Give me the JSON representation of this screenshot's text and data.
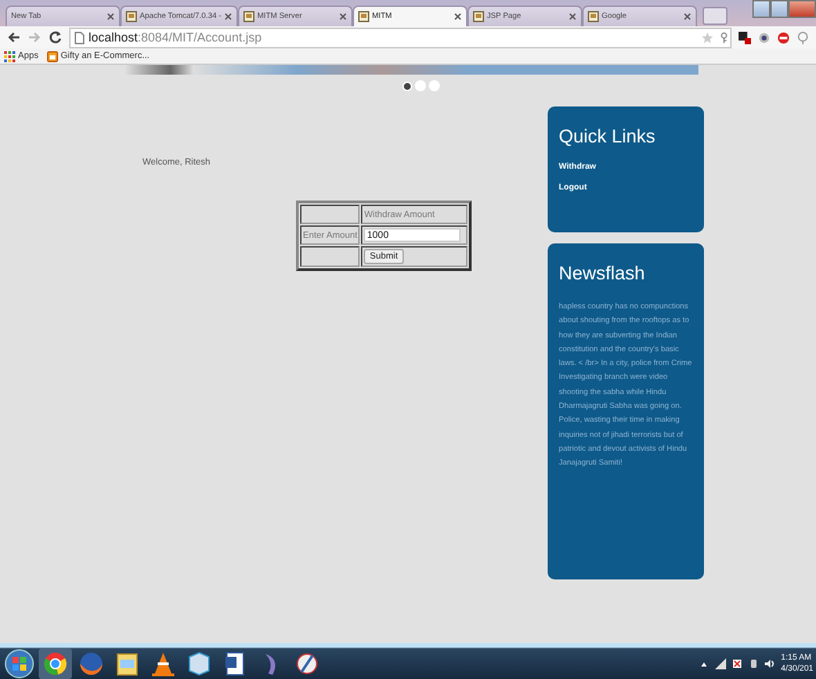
{
  "browser": {
    "tabs": [
      {
        "title": "New Tab",
        "selected": false,
        "favicon": false
      },
      {
        "title": "Apache Tomcat/7.0.34 -",
        "selected": false,
        "favicon": true
      },
      {
        "title": "MITM Server",
        "selected": false,
        "favicon": true
      },
      {
        "title": "MITM",
        "selected": true,
        "favicon": true
      },
      {
        "title": "JSP Page",
        "selected": false,
        "favicon": true
      },
      {
        "title": "Google",
        "selected": false,
        "favicon": true
      }
    ],
    "url": {
      "host": "localhost",
      "path": ":8084/MIT/Account.jsp"
    },
    "bookmarks": [
      "Apps",
      "Gifty an E-Commerc..."
    ]
  },
  "carousel": {
    "dots": [
      {
        "selected": true
      },
      {
        "selected": false
      },
      {
        "selected": false
      }
    ]
  },
  "welcome": "Welcome, Ritesh",
  "form": {
    "header": "Withdraw Amount",
    "label": "Enter Amount",
    "value": "1000",
    "button": "Submit"
  },
  "quick_links": {
    "title": "Quick Links",
    "links": [
      "Withdraw",
      "Logout"
    ]
  },
  "newsflash": {
    "title": "Newsflash",
    "text": "hapless country has no compunctions about shouting from the rooftops as to how they are subverting the Indian constitution and the country's basic laws. < /br> In a city, police from Crime Investigating branch were video shooting the sabha while Hindu Dharmajagruti Sabha was going on. Police, wasting their time in making inquiries not of jihadi terrorists but of patriotic and devout activists of Hindu Janajagruti Samiti!"
  },
  "taskbar": {
    "time": "1:15 AM",
    "date": "4/30/201"
  }
}
